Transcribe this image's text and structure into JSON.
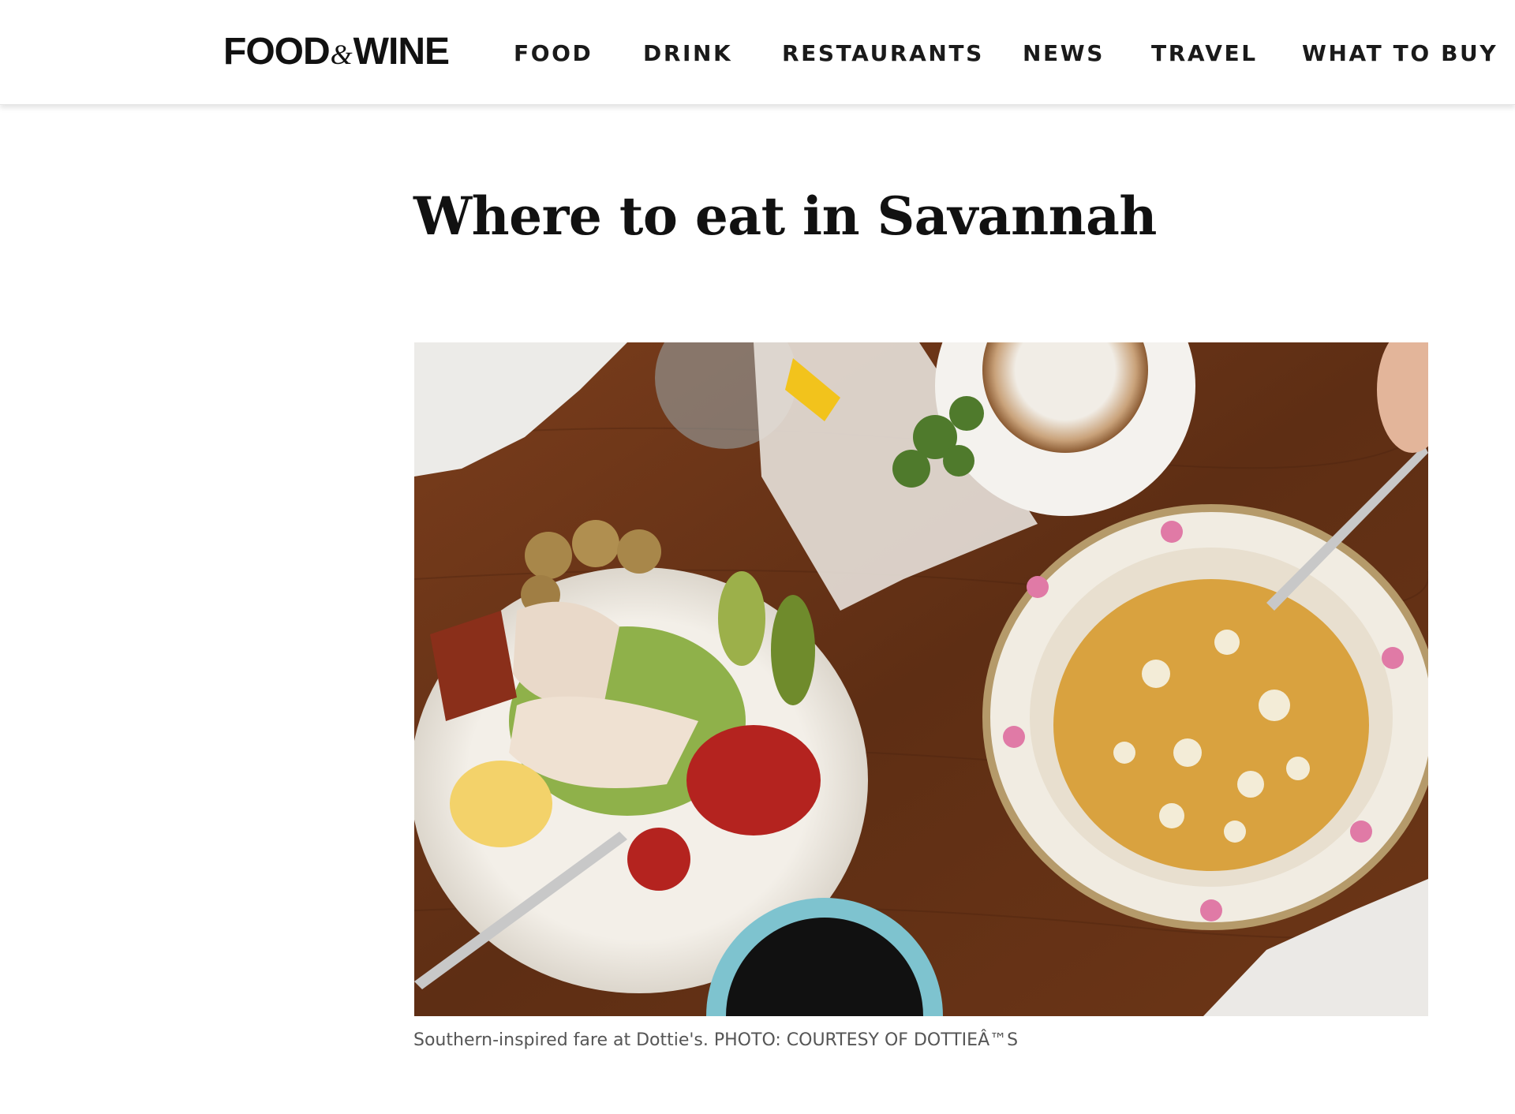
{
  "brand": {
    "logo_left": "FOOD",
    "logo_amp": "&",
    "logo_right": "WINE"
  },
  "nav": {
    "items": [
      {
        "label": "FOOD"
      },
      {
        "label": "DRINK"
      },
      {
        "label": "RESTAURANTS"
      },
      {
        "label": "NEWS"
      },
      {
        "label": "TRAVEL"
      },
      {
        "label": "WHAT TO BUY"
      }
    ]
  },
  "article": {
    "title": "Where to eat in Savannah",
    "caption": "Southern-inspired fare at Dottie's. PHOTO: COURTESY OF DOTTIEÂ™S"
  },
  "colors": {
    "text": "#111111",
    "caption": "#555555",
    "table_wood": "#6a3518"
  }
}
